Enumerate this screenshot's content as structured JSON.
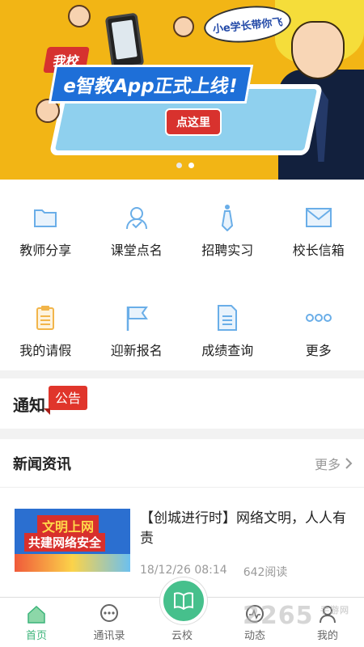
{
  "banner": {
    "bubble_text": "小e学长带你飞",
    "school_tag": "我校",
    "title": "e智教App正式上线!",
    "cta": "点这里",
    "slide_index": 2,
    "slide_count": 2
  },
  "grid": {
    "items": [
      {
        "label": "教师分享",
        "icon": "folder-icon"
      },
      {
        "label": "课堂点名",
        "icon": "user-check-icon"
      },
      {
        "label": "招聘实习",
        "icon": "tie-icon"
      },
      {
        "label": "校长信箱",
        "icon": "mail-icon"
      },
      {
        "label": "我的请假",
        "icon": "clipboard-icon"
      },
      {
        "label": "迎新报名",
        "icon": "flag-icon"
      },
      {
        "label": "成绩查询",
        "icon": "document-icon"
      },
      {
        "label": "更多",
        "icon": "more-dots-icon"
      }
    ]
  },
  "notice": {
    "title": "通知",
    "badge": "公告"
  },
  "news": {
    "title": "新闻资讯",
    "more": "更多",
    "items": [
      {
        "thumb_line1": "文明上网",
        "thumb_line2": "共建网络安全",
        "headline": "【创城进行时】网络文明，人人有责",
        "date": "18/12/26 08:14",
        "views": "642阅读"
      }
    ]
  },
  "nav": {
    "items": [
      {
        "label": "首页",
        "icon": "home-icon",
        "active": true
      },
      {
        "label": "通讯录",
        "icon": "chat-icon",
        "active": false
      },
      {
        "label": "云校",
        "icon": "book-icon",
        "active": false
      },
      {
        "label": "动态",
        "icon": "activity-icon",
        "active": false
      },
      {
        "label": "我的",
        "icon": "profile-icon",
        "active": false
      }
    ]
  },
  "watermark": {
    "text": "2265",
    "subtext": "手游网"
  },
  "colors": {
    "accent": "#46c08c",
    "banner_bg": "#f2b515",
    "badge_red": "#e0352b",
    "icon_blue": "#6aaee8",
    "icon_orange": "#f2b54a"
  }
}
